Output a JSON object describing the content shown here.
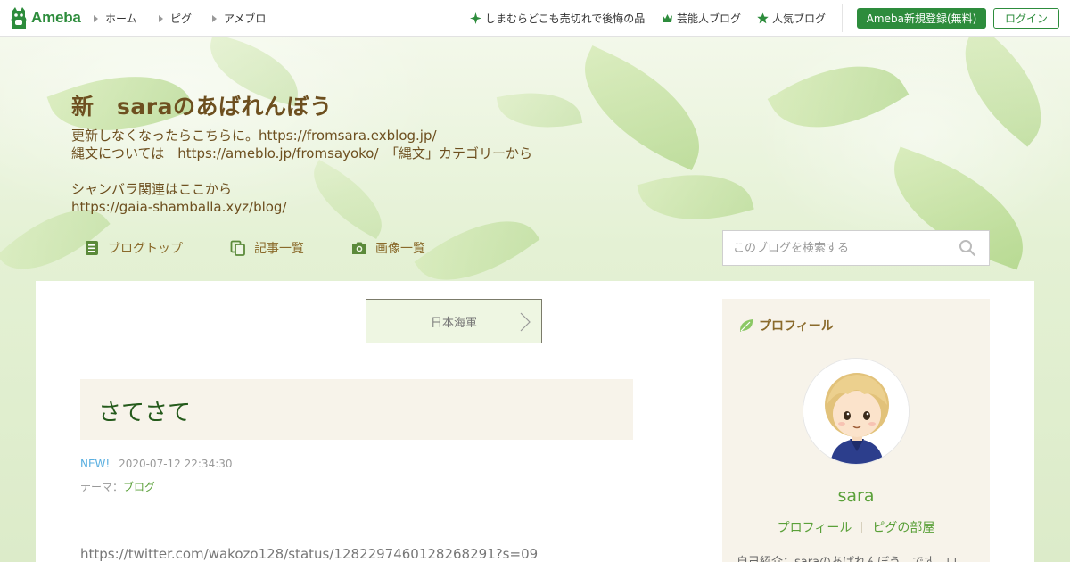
{
  "topbar": {
    "logo_text": "Ameba",
    "nav": [
      {
        "label": "ホーム"
      },
      {
        "label": "ピグ"
      },
      {
        "label": "アメブロ"
      }
    ],
    "promos": [
      {
        "label": "しまむらどこも売切れで後悔の品",
        "icon": "sparkle-icon"
      },
      {
        "label": "芸能人ブログ",
        "icon": "crown-icon"
      },
      {
        "label": "人気ブログ",
        "icon": "star-icon"
      }
    ],
    "register_label": "Ameba新規登録(無料)",
    "login_label": "ログイン",
    "brand_color": "#2d8c3c"
  },
  "blog": {
    "title": "新　saraのあばれんぼう",
    "desc": [
      "更新しなくなったらこちらに。https://fromsara.exblog.jp/",
      "縄文については　https://ameblo.jp/fromsayoko/　「縄文」カテゴリーから",
      "",
      "シャンバラ関連はここから",
      "https://gaia-shamballa.xyz/blog/"
    ],
    "nav": [
      {
        "label": "ブログトップ",
        "icon": "document-icon"
      },
      {
        "label": "記事一覧",
        "icon": "copy-icon"
      },
      {
        "label": "画像一覧",
        "icon": "camera-icon"
      }
    ],
    "search_placeholder": "このブログを検索する"
  },
  "entry": {
    "theme_nav_label": "日本海軍",
    "title": "さてさて",
    "new_badge": "NEW!",
    "datetime": "2020-07-12 22:34:30",
    "theme_prefix": "テーマ：",
    "theme": "ブログ",
    "body_link": "https://twitter.com/wakozo128/status/1282297460128268291?s=09"
  },
  "profile": {
    "heading": "プロフィール",
    "name": "sara",
    "links": [
      "プロフィール",
      "ピグの部屋"
    ],
    "intro": "自己紹介：saraのあばれんぼう、です。ロ"
  }
}
